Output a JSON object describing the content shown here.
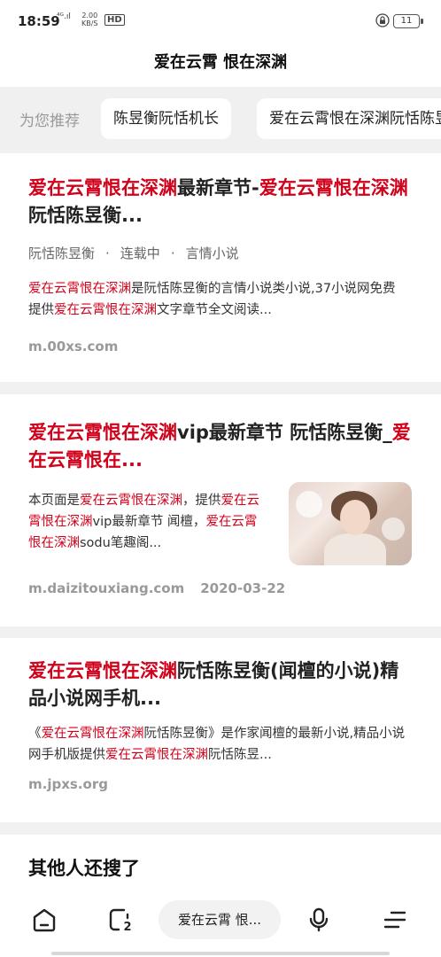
{
  "status": {
    "time": "18:59",
    "signal": "⁴ᴳ.ıl",
    "speed_top": "2.00",
    "speed_bottom": "KB/S",
    "hd": "HD",
    "battery": "11"
  },
  "header": {
    "title": "爱在云霄 恨在深渊"
  },
  "recommend": {
    "label": "为您推荐",
    "chips": [
      "陈昱衡阮恬机长",
      "爱在云霄恨在深渊阮恬陈昱衡"
    ]
  },
  "results": [
    {
      "title_parts": [
        {
          "text": "爱在云霄恨在深渊",
          "hl": true
        },
        {
          "text": "最新章节-",
          "hl": false
        },
        {
          "text": "爱在云霄恨在深渊",
          "hl": true
        },
        {
          "text": "阮恬陈昱衡...",
          "hl": false
        }
      ],
      "meta": [
        "阮恬陈昱衡",
        "连载中",
        "言情小说"
      ],
      "snippet_parts": [
        {
          "text": "爱在云霄恨在深渊",
          "hl": true
        },
        {
          "text": "是阮恬陈昱衡的言情小说类小说,37小说网免费提供",
          "hl": false
        },
        {
          "text": "爱在云霄恨在深渊",
          "hl": true
        },
        {
          "text": "文字章节全文阅读...",
          "hl": false
        }
      ],
      "url": "m.00xs.com"
    },
    {
      "title_parts": [
        {
          "text": "爱在云霄恨在深渊",
          "hl": true
        },
        {
          "text": "vip最新章节 阮恬陈昱衡_",
          "hl": false
        },
        {
          "text": "爱在云霄恨在...",
          "hl": true
        }
      ],
      "snippet_parts": [
        {
          "text": "本页面是",
          "hl": false
        },
        {
          "text": "爱在云霄恨在深渊",
          "hl": true
        },
        {
          "text": "，提供",
          "hl": false
        },
        {
          "text": "爱在云霄恨在深渊",
          "hl": true
        },
        {
          "text": "vip最新章节 闻檀，",
          "hl": false
        },
        {
          "text": "爱在云霄恨在深渊",
          "hl": true
        },
        {
          "text": "sodu笔趣阁...",
          "hl": false
        }
      ],
      "url": "m.daizitouxiang.com",
      "date": "2020-03-22"
    },
    {
      "title_parts": [
        {
          "text": "爱在云霄恨在深渊",
          "hl": true
        },
        {
          "text": "阮恬陈昱衡(闻檀的小说)精品小说网手机...",
          "hl": false
        }
      ],
      "snippet_parts": [
        {
          "text": "《",
          "hl": false
        },
        {
          "text": "爱在云霄恨在深渊",
          "hl": true
        },
        {
          "text": "阮恬陈昱衡》是作家闻檀的最新小说,精品小说网手机版提供",
          "hl": false
        },
        {
          "text": "爱在云霄恨在深渊",
          "hl": true
        },
        {
          "text": "阮恬陈昱...",
          "hl": false
        }
      ],
      "url": "m.jpxs.org"
    }
  ],
  "others": {
    "title": "其他人还搜了"
  },
  "bottom_nav": {
    "search_text": "爱在云霄 恨...",
    "tab_count": "2",
    "icons": [
      "home-icon",
      "tabs-icon",
      "mic-icon",
      "menu-icon"
    ]
  },
  "colors": {
    "highlight": "#d0021b",
    "background": "#f1f1f1",
    "card": "#ffffff"
  }
}
